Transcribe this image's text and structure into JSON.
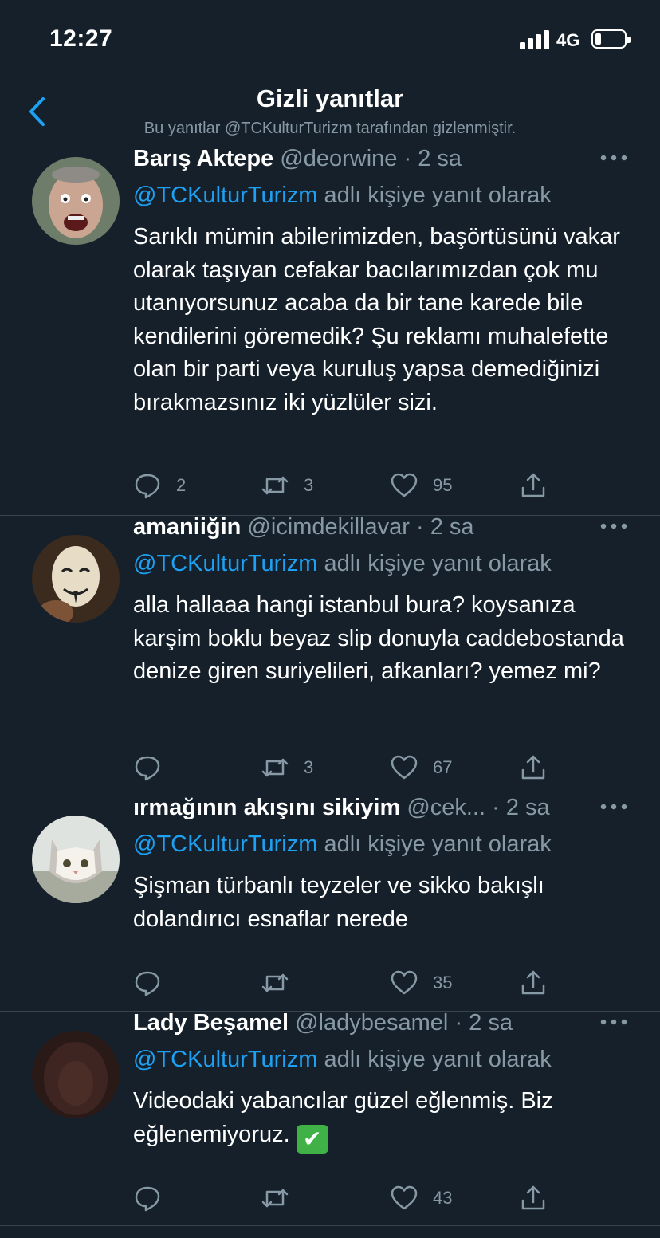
{
  "status_bar": {
    "time": "12:27",
    "network": "4G"
  },
  "header": {
    "title": "Gizli yanıtlar",
    "subtitle": "Bu yanıtlar @TCKulturTurizm tarafından gizlenmiştir."
  },
  "tweets": [
    {
      "name": "Barış Aktepe",
      "handle": "@deorwine",
      "dot": "·",
      "time": "2 sa",
      "reply_mention": "@TCKulturTurizm",
      "reply_suffix": "adlı kişiye yanıt olarak",
      "text": "Sarıklı mümin abilerimizden, başörtüsünü vakar olarak taşıyan cefakar bacılarımızdan çok mu utanıyorsunuz acaba da bir tane karede bile kendilerini göremedik? Şu reklamı muhalefette olan bir parti veya kuruluş yapsa demediğinizi bırakmazsınız iki yüzlüler sizi.",
      "replies": "2",
      "retweets": "3",
      "likes": "95"
    },
    {
      "name": "amaniiğin",
      "handle": "@icimdekillavar",
      "dot": "·",
      "time": "2 sa",
      "reply_mention": "@TCKulturTurizm",
      "reply_suffix": "adlı kişiye yanıt olarak",
      "text": "alla hallaaa hangi istanbul bura? koysanıza karşim boklu beyaz slip donuyla caddebostanda denize giren suriyelileri, afkanları? yemez mi?",
      "replies": "",
      "retweets": "3",
      "likes": "67"
    },
    {
      "name": "ırmağının akışını sikiyim",
      "handle": "@cek...",
      "dot": "·",
      "time": "2 sa",
      "reply_mention": "@TCKulturTurizm",
      "reply_suffix": "adlı kişiye yanıt olarak",
      "text": "Şişman türbanlı teyzeler ve sikko bakışlı dolandırıcı esnaflar nerede",
      "replies": "",
      "retweets": "",
      "likes": "35"
    },
    {
      "name": "Lady Beşamel",
      "handle": "@ladybesamel",
      "dot": "·",
      "time": "2 sa",
      "reply_mention": "@TCKulturTurizm",
      "reply_suffix": "adlı kişiye yanıt olarak",
      "text": "Videodaki yabancılar güzel eğlenmiş. Biz eğlenemiyoruz.",
      "emoji": "✔",
      "replies": "",
      "retweets": "",
      "likes": "43"
    }
  ]
}
